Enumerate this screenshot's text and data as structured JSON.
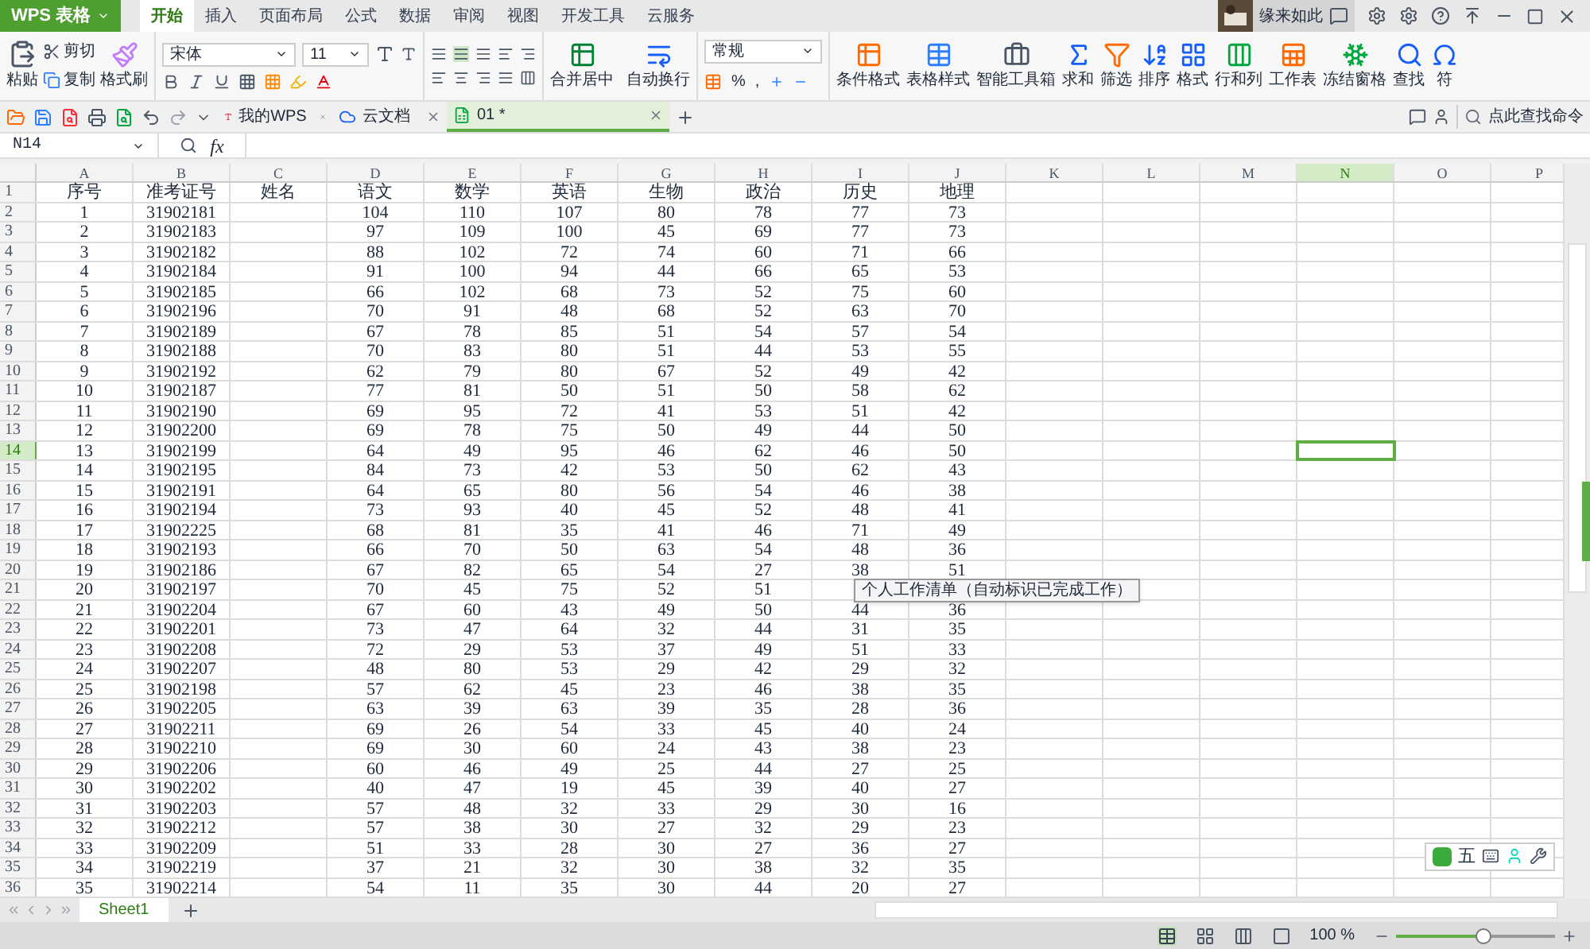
{
  "app": {
    "logo": "WPS 表格"
  },
  "tabs": [
    {
      "label": "开始",
      "selected": true
    },
    {
      "label": "插入",
      "selected": false
    },
    {
      "label": "页面布局",
      "selected": false
    },
    {
      "label": "公式",
      "selected": false
    },
    {
      "label": "数据",
      "selected": false
    },
    {
      "label": "审阅",
      "selected": false
    },
    {
      "label": "视图",
      "selected": false
    },
    {
      "label": "开发工具",
      "selected": false
    },
    {
      "label": "云服务",
      "selected": false
    }
  ],
  "user": {
    "name": "缘来如此"
  },
  "clipboard": {
    "paste": "粘贴",
    "cut": "剪切",
    "copy": "复制",
    "format_painter": "格式刷"
  },
  "font": {
    "name": "宋体",
    "size": "11"
  },
  "alignment": {
    "merge": "合并居中",
    "wrap": "自动换行"
  },
  "number": {
    "format": "常规",
    "percent": "%",
    "comma": ","
  },
  "tools": [
    {
      "kind": "conditional",
      "label": "条件格式"
    },
    {
      "kind": "table-style",
      "label": "表格样式"
    },
    {
      "kind": "toolbox",
      "label": "智能工具箱"
    },
    {
      "kind": "sum",
      "label": "求和"
    },
    {
      "kind": "filter",
      "label": "筛选"
    },
    {
      "kind": "sort",
      "label": "排序"
    },
    {
      "kind": "format",
      "label": "格式"
    },
    {
      "kind": "rows-cols",
      "label": "行和列"
    },
    {
      "kind": "sheet",
      "label": "工作表"
    },
    {
      "kind": "freeze",
      "label": "冻结窗格"
    },
    {
      "kind": "find",
      "label": "查找"
    },
    {
      "kind": "symbol",
      "label": "符"
    }
  ],
  "doc_tabs": [
    {
      "kind": "wps",
      "label": "我的WPS",
      "selected": false
    },
    {
      "kind": "cloud",
      "label": "云文档",
      "selected": false
    },
    {
      "kind": "sheet",
      "label": "01 *",
      "selected": true
    }
  ],
  "command_search": {
    "placeholder": "点此查找命令"
  },
  "formula_bar": {
    "name_box": "N14",
    "fx": "fx"
  },
  "columns": [
    {
      "label": "A",
      "selected": false
    },
    {
      "label": "B",
      "selected": false
    },
    {
      "label": "C",
      "selected": false
    },
    {
      "label": "D",
      "selected": false
    },
    {
      "label": "E",
      "selected": false
    },
    {
      "label": "F",
      "selected": false
    },
    {
      "label": "G",
      "selected": false
    },
    {
      "label": "H",
      "selected": false
    },
    {
      "label": "I",
      "selected": false
    },
    {
      "label": "J",
      "selected": false
    },
    {
      "label": "K",
      "selected": false
    },
    {
      "label": "L",
      "selected": false
    },
    {
      "label": "M",
      "selected": false
    },
    {
      "label": "N",
      "selected": true
    },
    {
      "label": "O",
      "selected": false
    },
    {
      "label": "P",
      "selected": false
    }
  ],
  "rows": [
    {
      "header": "1",
      "selected": false,
      "cells": [
        "序号",
        "准考证号",
        "姓名",
        "语文",
        "数学",
        "英语",
        "生物",
        "政治",
        "历史",
        "地理"
      ]
    },
    {
      "header": "2",
      "selected": false,
      "cells": [
        "1",
        "31902181",
        null,
        "104",
        "110",
        "107",
        "80",
        "78",
        "77",
        "73"
      ]
    },
    {
      "header": "3",
      "selected": false,
      "cells": [
        "2",
        "31902183",
        null,
        "97",
        "109",
        "100",
        "45",
        "69",
        "77",
        "73"
      ]
    },
    {
      "header": "4",
      "selected": false,
      "cells": [
        "3",
        "31902182",
        null,
        "88",
        "102",
        "72",
        "74",
        "60",
        "71",
        "66"
      ]
    },
    {
      "header": "5",
      "selected": false,
      "cells": [
        "4",
        "31902184",
        null,
        "91",
        "100",
        "94",
        "44",
        "66",
        "65",
        "53"
      ]
    },
    {
      "header": "6",
      "selected": false,
      "cells": [
        "5",
        "31902185",
        null,
        "66",
        "102",
        "68",
        "73",
        "52",
        "75",
        "60"
      ]
    },
    {
      "header": "7",
      "selected": false,
      "cells": [
        "6",
        "31902196",
        null,
        "70",
        "91",
        "48",
        "68",
        "52",
        "63",
        "70"
      ]
    },
    {
      "header": "8",
      "selected": false,
      "cells": [
        "7",
        "31902189",
        null,
        "67",
        "78",
        "85",
        "51",
        "54",
        "57",
        "54"
      ]
    },
    {
      "header": "9",
      "selected": false,
      "cells": [
        "8",
        "31902188",
        null,
        "70",
        "83",
        "80",
        "51",
        "44",
        "53",
        "55"
      ]
    },
    {
      "header": "10",
      "selected": false,
      "cells": [
        "9",
        "31902192",
        null,
        "62",
        "79",
        "80",
        "67",
        "52",
        "49",
        "42"
      ]
    },
    {
      "header": "11",
      "selected": false,
      "cells": [
        "10",
        "31902187",
        null,
        "77",
        "81",
        "50",
        "51",
        "50",
        "58",
        "62"
      ]
    },
    {
      "header": "12",
      "selected": false,
      "cells": [
        "11",
        "31902190",
        null,
        "69",
        "95",
        "72",
        "41",
        "53",
        "51",
        "42"
      ]
    },
    {
      "header": "13",
      "selected": false,
      "cells": [
        "12",
        "31902200",
        null,
        "69",
        "78",
        "75",
        "50",
        "49",
        "44",
        "50"
      ]
    },
    {
      "header": "14",
      "selected": true,
      "cells": [
        "13",
        "31902199",
        null,
        "64",
        "49",
        "95",
        "46",
        "62",
        "46",
        "50"
      ]
    },
    {
      "header": "15",
      "selected": false,
      "cells": [
        "14",
        "31902195",
        null,
        "84",
        "73",
        "42",
        "53",
        "50",
        "62",
        "43"
      ]
    },
    {
      "header": "16",
      "selected": false,
      "cells": [
        "15",
        "31902191",
        null,
        "64",
        "65",
        "80",
        "56",
        "54",
        "46",
        "38"
      ]
    },
    {
      "header": "17",
      "selected": false,
      "cells": [
        "16",
        "31902194",
        null,
        "73",
        "93",
        "40",
        "45",
        "52",
        "48",
        "41"
      ]
    },
    {
      "header": "18",
      "selected": false,
      "cells": [
        "17",
        "31902225",
        null,
        "68",
        "81",
        "35",
        "41",
        "46",
        "71",
        "49"
      ]
    },
    {
      "header": "19",
      "selected": false,
      "cells": [
        "18",
        "31902193",
        null,
        "66",
        "70",
        "50",
        "63",
        "54",
        "48",
        "36"
      ]
    },
    {
      "header": "20",
      "selected": false,
      "cells": [
        "19",
        "31902186",
        null,
        "67",
        "82",
        "65",
        "54",
        "27",
        "38",
        "51"
      ]
    },
    {
      "header": "21",
      "selected": false,
      "cells": [
        "20",
        "31902197",
        null,
        "70",
        "45",
        "75",
        "52",
        "51"
      ]
    },
    {
      "header": "22",
      "selected": false,
      "cells": [
        "21",
        "31902204",
        null,
        "67",
        "60",
        "43",
        "49",
        "50",
        "44",
        "36"
      ]
    },
    {
      "header": "23",
      "selected": false,
      "cells": [
        "22",
        "31902201",
        null,
        "73",
        "47",
        "64",
        "32",
        "44",
        "31",
        "35"
      ]
    },
    {
      "header": "24",
      "selected": false,
      "cells": [
        "23",
        "31902208",
        null,
        "72",
        "29",
        "53",
        "37",
        "49",
        "51",
        "33"
      ]
    },
    {
      "header": "25",
      "selected": false,
      "cells": [
        "24",
        "31902207",
        null,
        "48",
        "80",
        "53",
        "29",
        "42",
        "29",
        "32"
      ]
    },
    {
      "header": "26",
      "selected": false,
      "cells": [
        "25",
        "31902198",
        null,
        "57",
        "62",
        "45",
        "23",
        "46",
        "38",
        "35"
      ]
    },
    {
      "header": "27",
      "selected": false,
      "cells": [
        "26",
        "31902205",
        null,
        "63",
        "39",
        "63",
        "39",
        "35",
        "28",
        "36"
      ]
    },
    {
      "header": "28",
      "selected": false,
      "cells": [
        "27",
        "31902211",
        null,
        "69",
        "26",
        "54",
        "33",
        "45",
        "40",
        "24"
      ]
    },
    {
      "header": "29",
      "selected": false,
      "cells": [
        "28",
        "31902210",
        null,
        "69",
        "30",
        "60",
        "24",
        "43",
        "38",
        "23"
      ]
    },
    {
      "header": "30",
      "selected": false,
      "cells": [
        "29",
        "31902206",
        null,
        "60",
        "46",
        "49",
        "25",
        "44",
        "27",
        "25"
      ]
    },
    {
      "header": "31",
      "selected": false,
      "cells": [
        "30",
        "31902202",
        null,
        "40",
        "47",
        "19",
        "45",
        "39",
        "40",
        "27"
      ]
    },
    {
      "header": "32",
      "selected": false,
      "cells": [
        "31",
        "31902203",
        null,
        "57",
        "48",
        "32",
        "33",
        "29",
        "30",
        "16"
      ]
    },
    {
      "header": "33",
      "selected": false,
      "cells": [
        "32",
        "31902212",
        null,
        "57",
        "38",
        "30",
        "27",
        "32",
        "29",
        "23"
      ]
    },
    {
      "header": "34",
      "selected": false,
      "cells": [
        "33",
        "31902209",
        null,
        "51",
        "33",
        "28",
        "30",
        "27",
        "36",
        "27"
      ]
    },
    {
      "header": "35",
      "selected": false,
      "cells": [
        "34",
        "31902219",
        null,
        "37",
        "21",
        "32",
        "30",
        "38",
        "32",
        "35"
      ]
    },
    {
      "header": "36",
      "selected": false,
      "cells": [
        "35",
        "31902214",
        null,
        "54",
        "11",
        "35",
        "30",
        "44",
        "20",
        "27"
      ]
    }
  ],
  "tooltip": "个人工作清单（自动标识已完成工作）",
  "sheet_tabs": [
    {
      "label": "Sheet1",
      "selected": true
    }
  ],
  "ime": {
    "mode": "五"
  },
  "status": {
    "zoom": "100 %",
    "level": 0.55
  }
}
